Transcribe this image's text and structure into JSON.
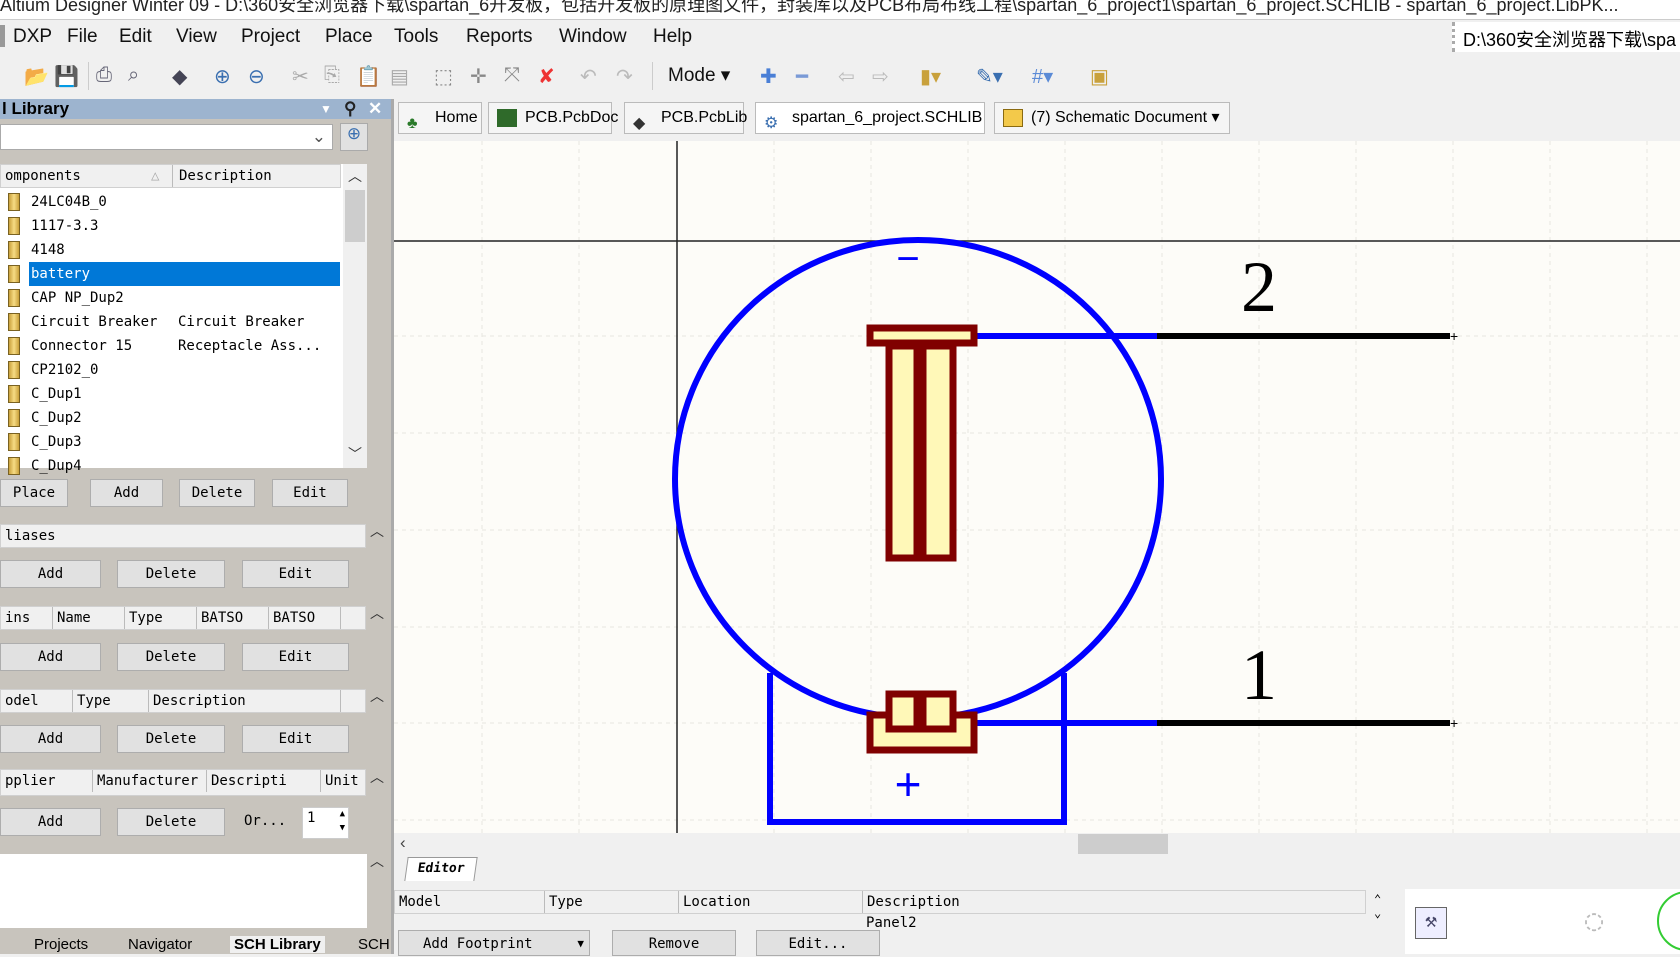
{
  "window": {
    "title": "Altium Designer Winter 09 - D:\\360安全浏览器下载\\spartan_6开发板，包括开发板的原理图文件，封装库以及PCB布局布线工程\\spartan_6_project1\\spartan_6_project.SCHLIB - spartan_6_project.LibPK..."
  },
  "menu": [
    "DXP",
    "File",
    "Edit",
    "View",
    "Project",
    "Place",
    "Tools",
    "Reports",
    "Window",
    "Help"
  ],
  "path_box": "D:\\360安全浏览器下载\\spa",
  "toolbar": {
    "mode_label": "Mode"
  },
  "doc_tabs": [
    {
      "label": "Home",
      "icon": "home-icon"
    },
    {
      "label": "PCB.PcbDoc",
      "icon": "pcb-doc-icon"
    },
    {
      "label": "PCB.PcbLib",
      "icon": "pcb-lib-icon"
    },
    {
      "label": "spartan_6_project.SCHLIB",
      "icon": "schlib-icon"
    },
    {
      "label": "(7) Schematic Document",
      "icon": "schematic-icon"
    }
  ],
  "panel": {
    "title": "l Library",
    "components_header": {
      "name": "omponents",
      "desc": "Description"
    },
    "components": [
      {
        "name": "24LC04B_0",
        "desc": ""
      },
      {
        "name": "1117-3.3",
        "desc": ""
      },
      {
        "name": "4148",
        "desc": ""
      },
      {
        "name": "battery",
        "desc": "",
        "selected": true
      },
      {
        "name": "CAP NP_Dup2",
        "desc": ""
      },
      {
        "name": "Circuit Breaker",
        "desc": "Circuit Breaker"
      },
      {
        "name": "Connector 15",
        "desc": "Receptacle Ass..."
      },
      {
        "name": "CP2102_0",
        "desc": ""
      },
      {
        "name": "C_Dup1",
        "desc": ""
      },
      {
        "name": "C_Dup2",
        "desc": ""
      },
      {
        "name": "C_Dup3",
        "desc": ""
      },
      {
        "name": "C_Dup4",
        "desc": ""
      }
    ],
    "comp_buttons": [
      "Place",
      "Add",
      "Delete",
      "Edit"
    ],
    "aliases_header": "liases",
    "pins_header": [
      "ins",
      "Name",
      "Type",
      "BATSO",
      "BATSO"
    ],
    "model_header": [
      "odel",
      "Type",
      "Description"
    ],
    "supplier_header": [
      "pplier",
      "Manufacturer",
      "Descripti",
      "Unit"
    ],
    "buttons": {
      "add": "Add",
      "delete": "Delete",
      "edit": "Edit",
      "order": "Or...",
      "qty": "1"
    },
    "bottom_tabs": [
      "Projects",
      "Navigator",
      "SCH Library",
      "SCH"
    ]
  },
  "symbol": {
    "pin2_label": "2",
    "pin1_label": "1",
    "minus": "−",
    "plus": "+"
  },
  "editor": {
    "tab": "Editor",
    "headers": [
      "Model",
      "Type",
      "Location",
      "Description"
    ],
    "row_desc": "Panel2",
    "buttons": [
      "Add Footprint",
      "Remove",
      "Edit..."
    ]
  }
}
